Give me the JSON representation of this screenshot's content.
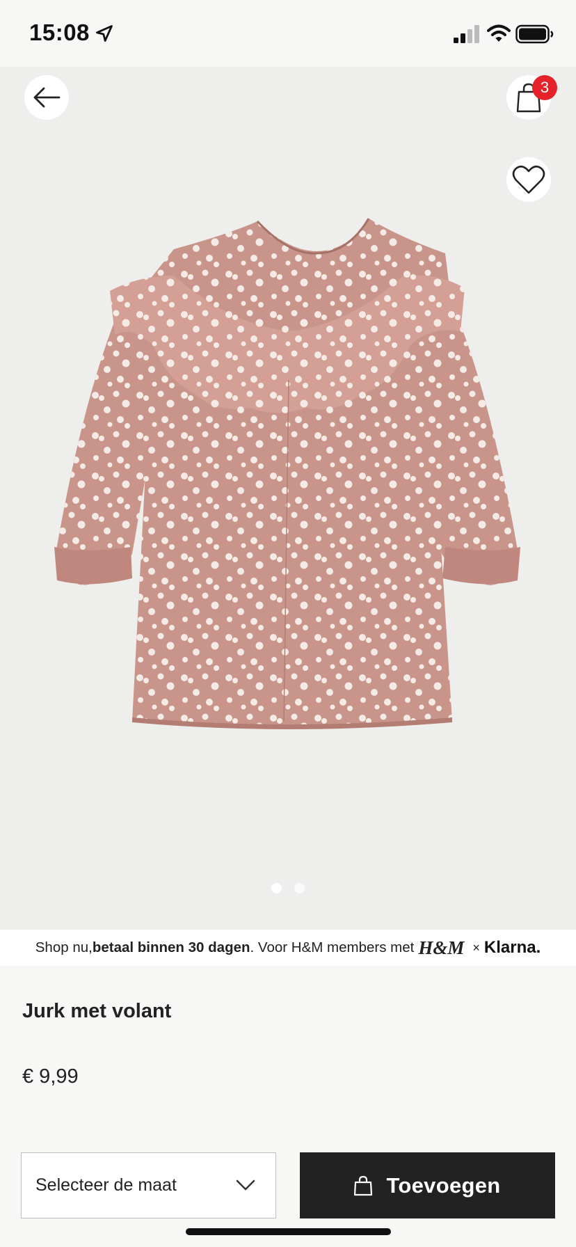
{
  "status_bar": {
    "time": "15:08",
    "icons": [
      "location-arrow-icon",
      "cellular-signal-icon",
      "wifi-icon",
      "battery-icon"
    ]
  },
  "header": {
    "back_icon": "arrow-left-icon",
    "bag_icon": "shopping-bag-icon",
    "cart_count": "3",
    "favorite_icon": "heart-outline-icon"
  },
  "gallery": {
    "image_count": 2,
    "active_index": 0
  },
  "promo": {
    "text_before": "Shop nu, ",
    "text_bold": "betaal binnen 30 dagen",
    "text_after": ". Voor H&M members met",
    "hm_logo": "H&M",
    "separator": "×",
    "klarna_logo": "Klarna."
  },
  "product": {
    "name": "Jurk met volant",
    "price": "€ 9,99"
  },
  "actions": {
    "size_select_label": "Selecteer de maat",
    "add_label": "Toevoegen"
  },
  "colors": {
    "badge": "#e5222a",
    "button_dark": "#222222",
    "dress_pink": "#c9948a"
  }
}
